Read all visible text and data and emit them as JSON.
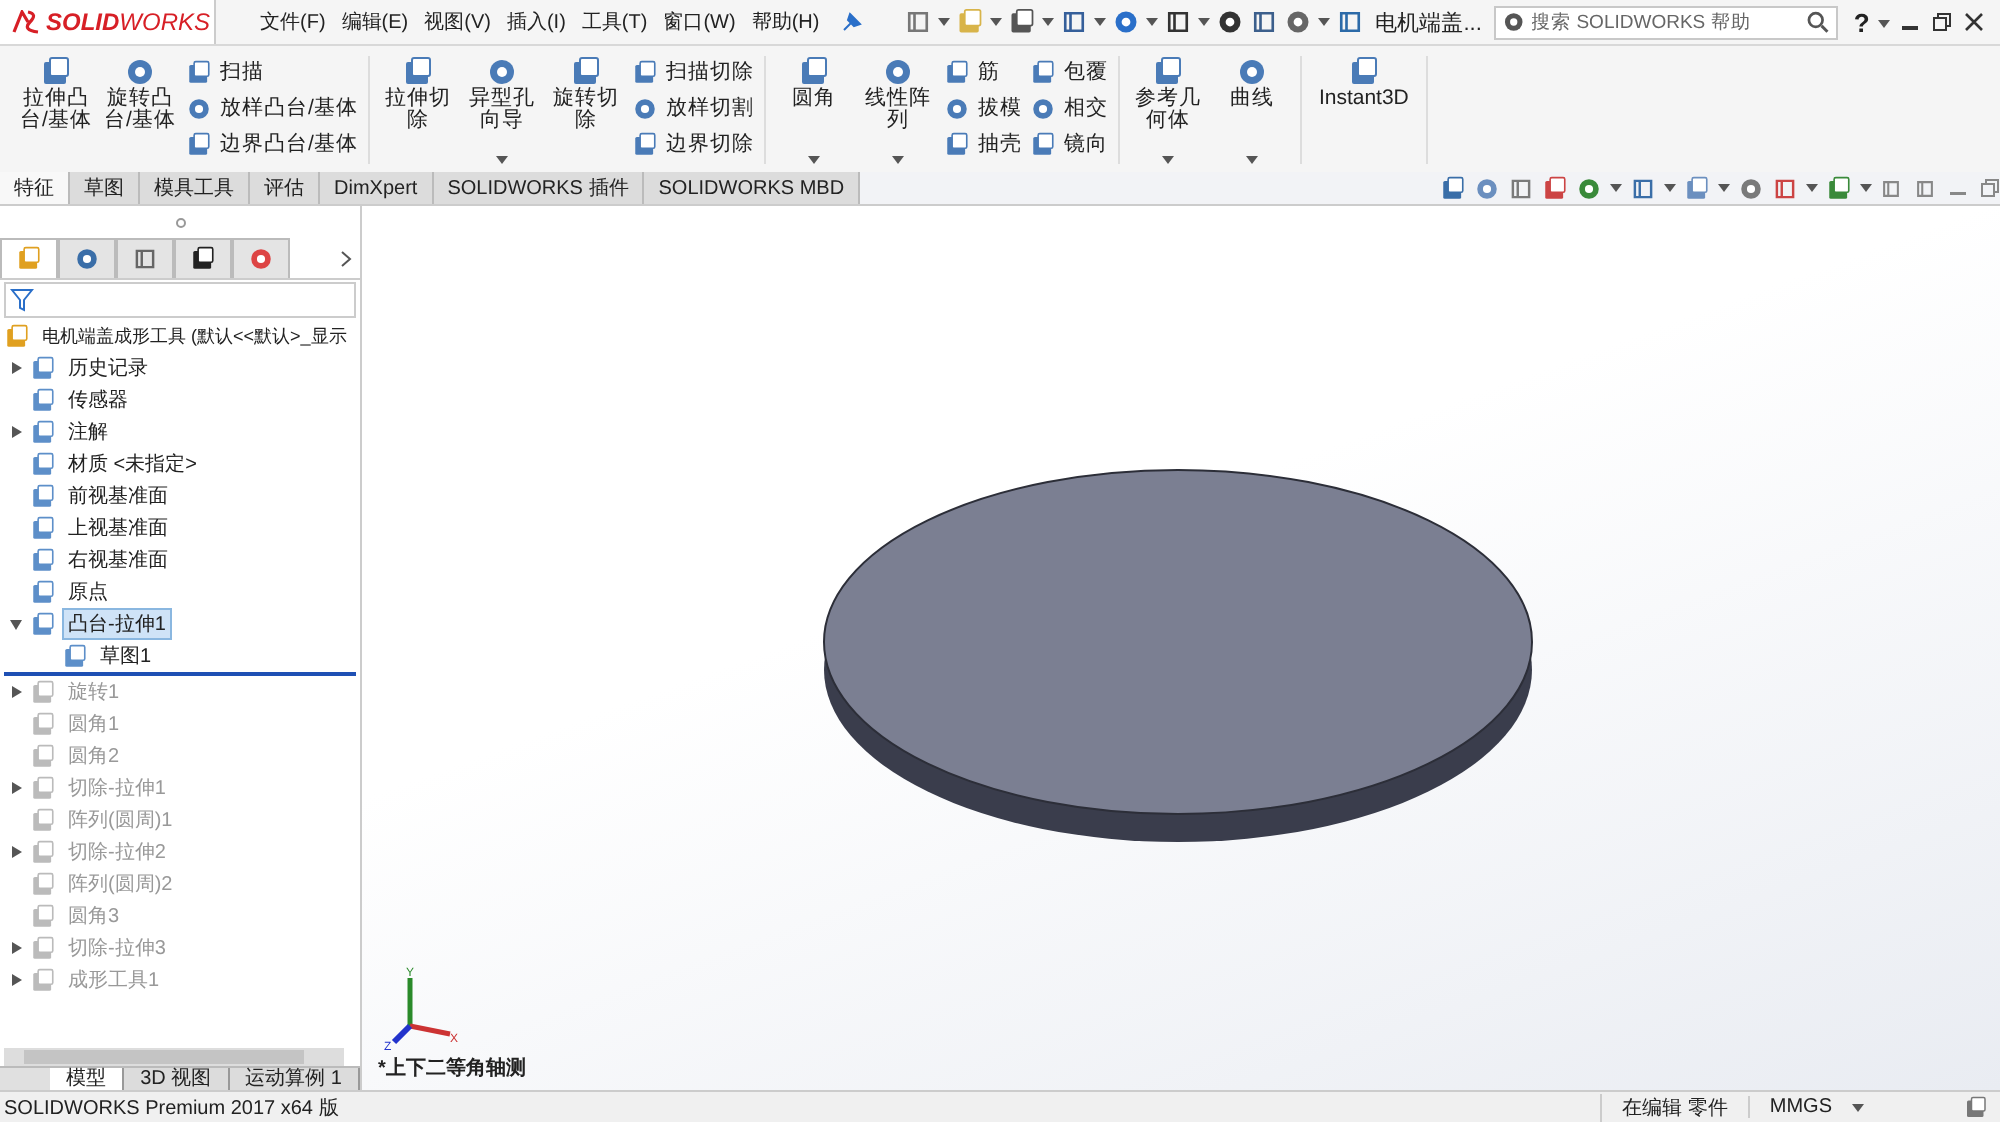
{
  "title_bar": {
    "logo": "**SOLID**WORKS",
    "menu": [
      "文件(F)",
      "编辑(E)",
      "视图(V)",
      "插入(I)",
      "工具(T)",
      "窗口(W)",
      "帮助(H)"
    ],
    "document": "电机端盖...",
    "search": {
      "placeholder": "搜索 SOLIDWORKS 帮助"
    },
    "help": "?"
  },
  "ribbon": [
    {
      "items": [
        {
          "kind": "large",
          "label": "拉伸凸台/基体",
          "dropdown": false
        },
        {
          "kind": "large",
          "label": "旋转凸台/基体",
          "dropdown": false
        },
        {
          "kind": "stack",
          "labels": [
            "扫描",
            "放样凸台/基体",
            "边界凸台/基体"
          ]
        }
      ]
    },
    {
      "items": [
        {
          "kind": "large",
          "label": "拉伸切除",
          "dropdown": false
        },
        {
          "kind": "large",
          "label": "异型孔向导",
          "dropdown": true
        },
        {
          "kind": "large",
          "label": "旋转切除",
          "dropdown": false
        },
        {
          "kind": "stack",
          "labels": [
            "扫描切除",
            "放样切割",
            "边界切除"
          ]
        }
      ]
    },
    {
      "items": [
        {
          "kind": "large",
          "label": "圆角",
          "dropdown": true
        },
        {
          "kind": "large",
          "label": "线性阵列",
          "dropdown": true
        },
        {
          "kind": "stack",
          "labels": [
            "筋",
            "拔模",
            "抽壳"
          ]
        },
        {
          "kind": "stack",
          "labels": [
            "包覆",
            "相交",
            "镜向"
          ]
        }
      ]
    },
    {
      "items": [
        {
          "kind": "large",
          "label": "参考几何体",
          "dropdown": true
        },
        {
          "kind": "large",
          "label": "曲线",
          "dropdown": true
        }
      ]
    },
    {
      "items": [
        {
          "kind": "wide",
          "label": "Instant3D",
          "dropdown": false
        }
      ]
    }
  ],
  "tabs": [
    {
      "label": "特征",
      "selected": true
    },
    {
      "label": "草图",
      "selected": false
    },
    {
      "label": "模具工具",
      "selected": false
    },
    {
      "label": "评估",
      "selected": false
    },
    {
      "label": "DimXpert",
      "selected": false
    },
    {
      "label": "SOLIDWORKS 插件",
      "selected": false
    },
    {
      "label": "SOLIDWORKS MBD",
      "selected": false
    }
  ],
  "tree": {
    "root": "电机端盖成形工具  (默认<<默认>_显示",
    "items": [
      {
        "label": "历史记录",
        "expandable": true,
        "expanded": false,
        "rolled_back": false,
        "selected": false
      },
      {
        "label": "传感器",
        "expandable": false,
        "rolled_back": false,
        "selected": false
      },
      {
        "label": "注解",
        "expandable": true,
        "expanded": false,
        "rolled_back": false,
        "selected": false
      },
      {
        "label": "材质 <未指定>",
        "expandable": false,
        "rolled_back": false,
        "selected": false
      },
      {
        "label": "前视基准面",
        "expandable": false,
        "rolled_back": false,
        "selected": false
      },
      {
        "label": "上视基准面",
        "expandable": false,
        "rolled_back": false,
        "selected": false
      },
      {
        "label": "右视基准面",
        "expandable": false,
        "rolled_back": false,
        "selected": false
      },
      {
        "label": "原点",
        "expandable": false,
        "rolled_back": false,
        "selected": false
      },
      {
        "label": "凸台-拉伸1",
        "expandable": true,
        "expanded": true,
        "rolled_back": false,
        "selected": true,
        "children": [
          {
            "label": "草图1",
            "expandable": false,
            "rolled_back": false,
            "selected": false
          }
        ]
      },
      {
        "label": "旋转1",
        "expandable": true,
        "expanded": false,
        "rolled_back": true,
        "selected": false
      },
      {
        "label": "圆角1",
        "expandable": false,
        "rolled_back": true,
        "selected": false
      },
      {
        "label": "圆角2",
        "expandable": false,
        "rolled_back": true,
        "selected": false
      },
      {
        "label": "切除-拉伸1",
        "expandable": true,
        "expanded": false,
        "rolled_back": true,
        "selected": false
      },
      {
        "label": "阵列(圆周)1",
        "expandable": false,
        "rolled_back": true,
        "selected": false
      },
      {
        "label": "切除-拉伸2",
        "expandable": true,
        "expanded": false,
        "rolled_back": true,
        "selected": false
      },
      {
        "label": "阵列(圆周)2",
        "expandable": false,
        "rolled_back": true,
        "selected": false
      },
      {
        "label": "圆角3",
        "expandable": false,
        "rolled_back": true,
        "selected": false
      },
      {
        "label": "切除-拉伸3",
        "expandable": true,
        "expanded": false,
        "rolled_back": true,
        "selected": false
      },
      {
        "label": "成形工具1",
        "expandable": true,
        "expanded": false,
        "rolled_back": true,
        "selected": false
      }
    ]
  },
  "panel_tabs": [
    {
      "selected": true
    },
    {
      "selected": false
    },
    {
      "selected": false
    },
    {
      "selected": false
    },
    {
      "selected": false
    }
  ],
  "viewport": {
    "view_name": "*上下二等角轴测",
    "axes": [
      "X",
      "Y",
      "Z"
    ]
  },
  "bottom_tabs": [
    {
      "label": "模型",
      "selected": true
    },
    {
      "label": "3D 视图",
      "selected": false
    },
    {
      "label": "运动算例 1",
      "selected": false
    }
  ],
  "status_bar": {
    "product": "SOLIDWORKS Premium 2017 x64 版",
    "mode": "在编辑 零件",
    "units": "MMGS"
  }
}
